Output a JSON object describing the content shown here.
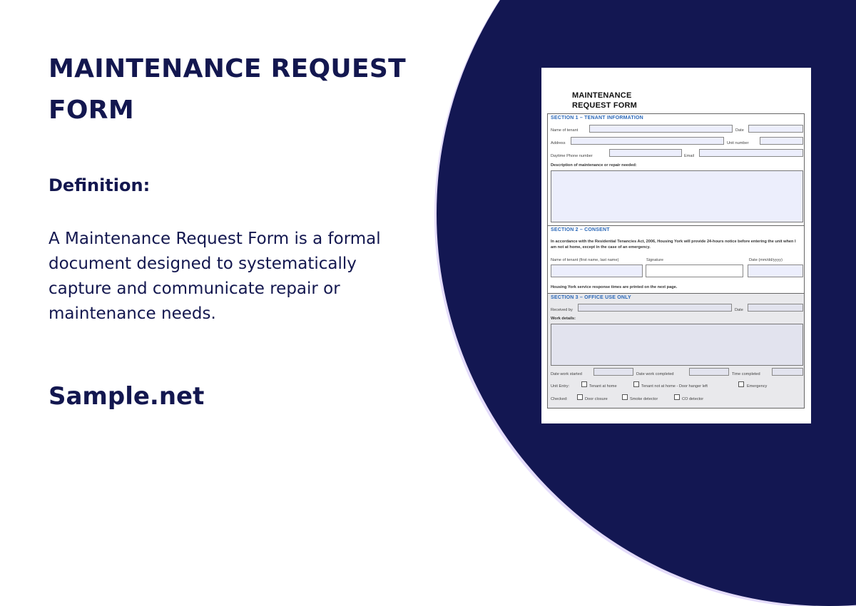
{
  "left_panel": {
    "title": "MAINTENANCE REQUEST FORM",
    "definition_heading": "Definition:",
    "definition_body": "A Maintenance Request Form is a formal document designed to systematically capture and communicate repair or maintenance needs.",
    "brand": "Sample.net"
  },
  "colors": {
    "primary_navy": "#13174f",
    "circle_bg": "#131752",
    "circle_outline": "#e4dcfb",
    "section_heading_blue": "#2b68b8",
    "field_fill": "#eceefc"
  },
  "document": {
    "title_line1": "MAINTENANCE",
    "title_line2": "REQUEST FORM",
    "section1": {
      "heading": "SECTION 1 – TENANT INFORMATION",
      "name_label": "Name of tenant",
      "date_label": "Date",
      "address_label": "Address",
      "unit_label": "Unit number",
      "phone_label": "Daytime Phone number",
      "email_label": "Email",
      "description_label": "Description of maintenance or repair needed:"
    },
    "section2": {
      "heading": "SECTION 2 – CONSENT",
      "consent_text": "In accordance with the Residential Tenancies Act, 2006, Housing York will provide 24-hours notice before entering the unit when I am not at home, except in the case of an emergency.",
      "name_label": "Name of tenant (first name, last name)",
      "signature_label": "Signature",
      "date_label": "Date (mm/dd/yyyy)",
      "footer_note": "Housing York service response times are printed on the next page."
    },
    "section3": {
      "heading": "SECTION 3 – OFFICE USE ONLY",
      "received_label": "Received by",
      "date_label": "Date",
      "work_details_label": "Work details:",
      "date_started_label": "Date work started",
      "date_completed_label": "Date work completed",
      "time_completed_label": "Time completed",
      "unit_entry_label": "Unit Entry:",
      "unit_entry_options": [
        "Tenant at home",
        "Tenant not at home - Door hanger left",
        "Emergency"
      ],
      "checked_label": "Checked:",
      "checked_options": [
        "Door closure",
        "Smoke detector",
        "CO detector"
      ]
    }
  }
}
